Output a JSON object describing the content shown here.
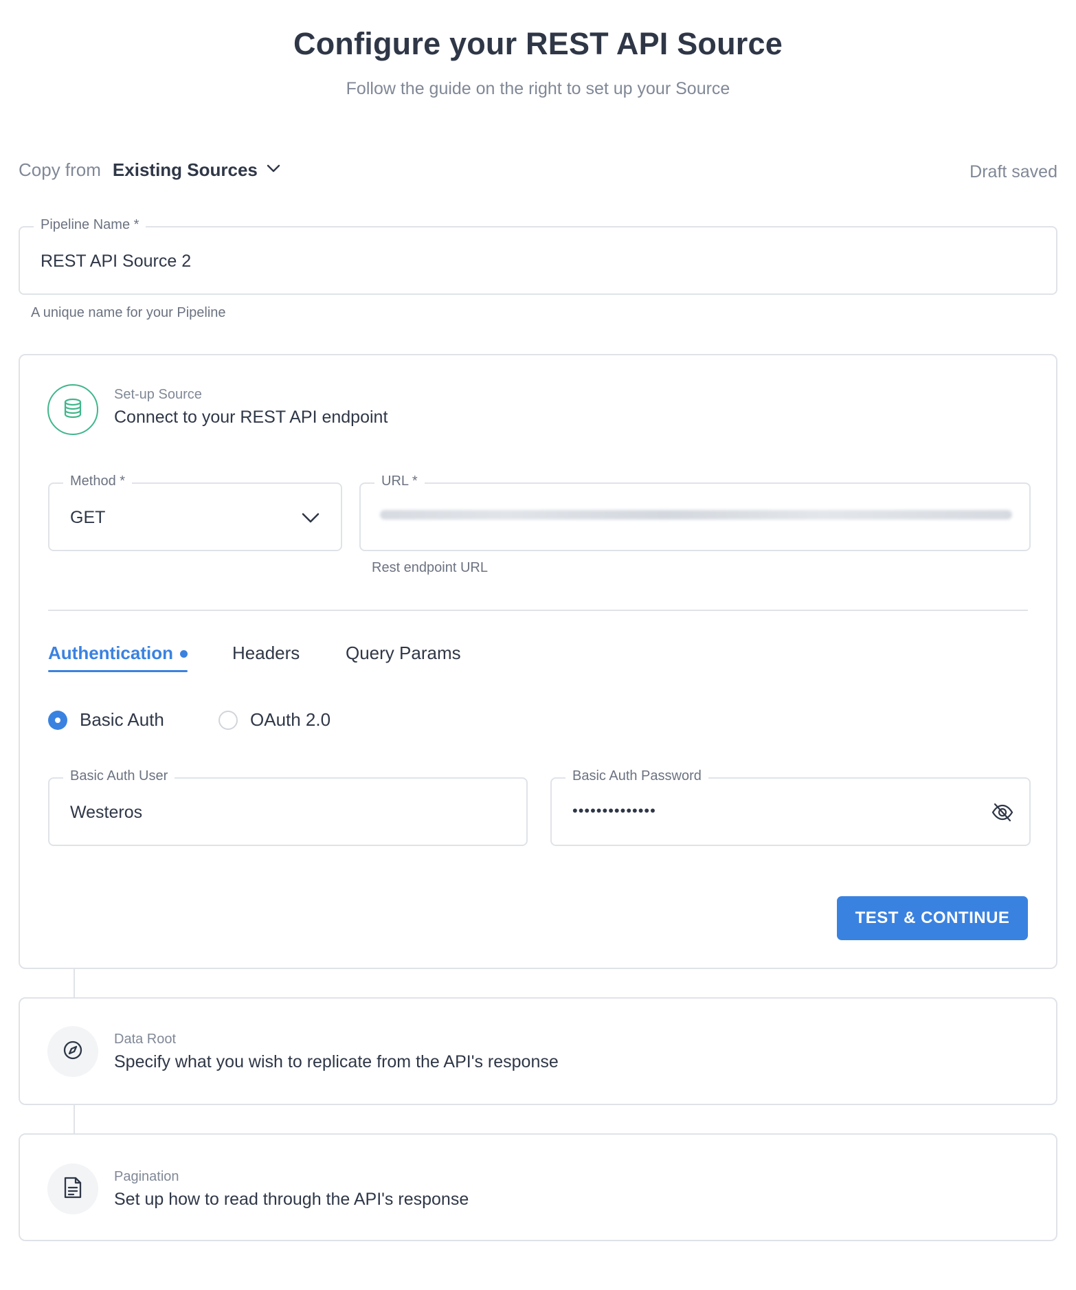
{
  "header": {
    "title": "Configure your REST API Source",
    "subtitle": "Follow the guide on the right to set up your Source"
  },
  "copy_from": {
    "label": "Copy from",
    "value": "Existing Sources"
  },
  "draft_status": "Draft saved",
  "pipeline_name": {
    "label": "Pipeline Name *",
    "value": "REST API Source 2",
    "helper": "A unique name for your Pipeline"
  },
  "setup_source": {
    "overline": "Set-up Source",
    "title": "Connect to your REST API endpoint",
    "method": {
      "label": "Method *",
      "value": "GET"
    },
    "url": {
      "label": "URL *",
      "helper": "Rest endpoint URL"
    },
    "tabs": [
      {
        "label": "Authentication"
      },
      {
        "label": "Headers"
      },
      {
        "label": "Query Params"
      }
    ],
    "auth_options": [
      {
        "label": "Basic Auth",
        "checked": true
      },
      {
        "label": "OAuth 2.0",
        "checked": false
      }
    ],
    "basic_auth_user": {
      "label": "Basic Auth User",
      "value": "Westeros"
    },
    "basic_auth_password": {
      "label": "Basic Auth Password",
      "value": "••••••••••••••"
    },
    "submit_label": "TEST & CONTINUE"
  },
  "data_root": {
    "overline": "Data Root",
    "title": "Specify what you wish to replicate from the API's response"
  },
  "pagination": {
    "overline": "Pagination",
    "title": "Set up how to read through the API's response"
  },
  "colors": {
    "accent": "#3a82e0",
    "success": "#3fb68b",
    "text": "#2f3747",
    "muted": "#808896",
    "border": "#dfe3e8"
  },
  "icons": {
    "copy_from": "chevron-down-icon",
    "method": "chevron-down-icon",
    "setup_source": "database-icon",
    "password": "eye-off-icon",
    "data_root": "compass-icon",
    "pagination": "document-icon"
  }
}
